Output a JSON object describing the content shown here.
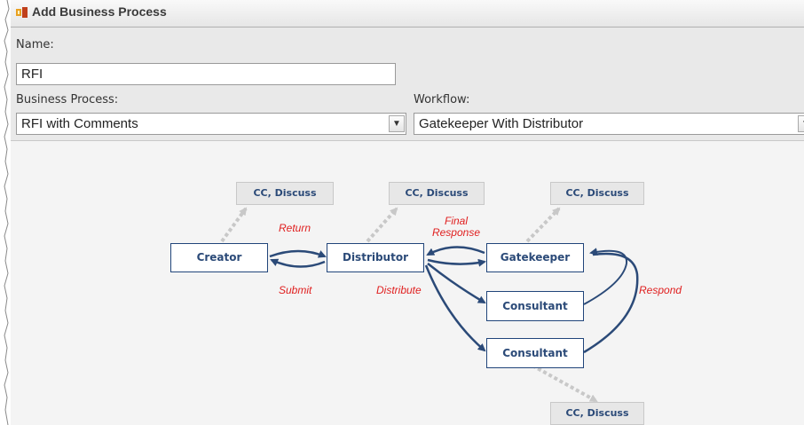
{
  "window": {
    "title": "Add Business Process",
    "icon": "process-app-icon"
  },
  "form": {
    "name_label": "Name:",
    "name_value": "RFI",
    "business_process_label": "Business Process:",
    "business_process_value": "RFI with Comments",
    "workflow_label": "Workflow:",
    "workflow_value": "Gatekeeper With Distributor"
  },
  "diagram": {
    "nodes": {
      "creator": "Creator",
      "distributor": "Distributor",
      "gatekeeper": "Gatekeeper",
      "consultant_1": "Consultant",
      "consultant_2": "Consultant"
    },
    "cc_discuss": [
      "CC, Discuss",
      "CC, Discuss",
      "CC, Discuss",
      "CC, Discuss"
    ],
    "transitions": {
      "return": "Return",
      "submit": "Submit",
      "final_response_line1": "Final",
      "final_response_line2": "Response",
      "distribute": "Distribute",
      "respond": "Respond"
    }
  }
}
